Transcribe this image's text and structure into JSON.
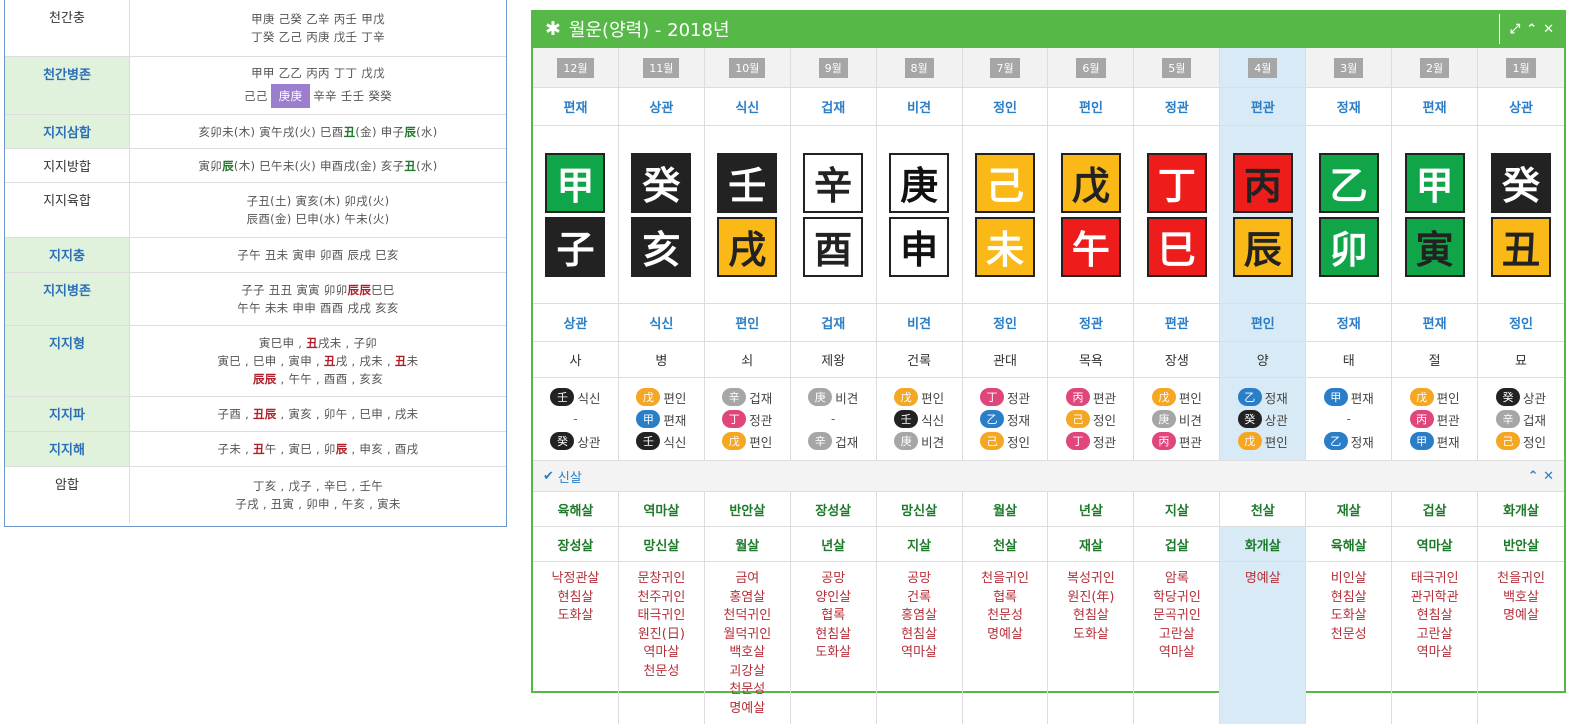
{
  "left_table": {
    "rows": [
      {
        "label": "천간충",
        "highlight": false,
        "lines": [
          "甲庚 己癸 乙辛 丙壬 甲戊",
          "丁癸 乙己 丙庚 戊壬 丁辛"
        ]
      },
      {
        "label": "천간병존",
        "highlight": true,
        "lines": [
          "甲甲 乙乙 丙丙 丁丁 戊戊"
        ],
        "line2_pre": "己己",
        "line2_box": "庚庚",
        "line2_post": "辛辛 壬壬 癸癸"
      },
      {
        "label": "지지삼합",
        "highlight": true,
        "line_a": "亥卯未(木) 寅午戌(火) 巳酉",
        "line_a_r1": "丑",
        "line_a_b": "(金) 申子",
        "line_a_r2": "辰",
        "line_a_c": "(水)"
      },
      {
        "label": "지지방합",
        "highlight": false,
        "line_a": "寅卯",
        "line_a_r1": "辰",
        "line_a_b": "(木) 巳午未(火) 申酉戌(金) 亥子",
        "line_a_r2": "丑",
        "line_a_c": "(水)"
      },
      {
        "label": "지지육합",
        "highlight": false,
        "lines": [
          "子丑(土) 寅亥(木) 卯戌(火)",
          "辰酉(金) 巳申(水) 午未(火)"
        ]
      },
      {
        "label": "지지충",
        "highlight": true,
        "lines": [
          "子午 丑未 寅申 卯酉 辰戌 巳亥"
        ]
      },
      {
        "label": "지지병존",
        "highlight": true,
        "line_a": "子子 丑丑 寅寅 卯卯",
        "line_a_r1": "辰辰",
        "line_a_b": "巳巳",
        "lines2": [
          "午午 未未 申申 酉酉 戌戌 亥亥"
        ]
      },
      {
        "label": "지지형",
        "highlight": true,
        "l1a": "寅巳申 , ",
        "l1r": "丑",
        "l1b": "戌未 , 子卯",
        "l2a": "寅巳 , 巳申 , 寅申 , ",
        "l2r1": "丑",
        "l2b": "戌 , 戌未 , ",
        "l2r2": "丑",
        "l2c": "未",
        "l3r": "辰辰",
        "l3b": " , 午午 , 酉酉 , 亥亥"
      },
      {
        "label": "지지파",
        "highlight": true,
        "la": "子酉 , ",
        "lr": "丑辰",
        "lb": " , 寅亥 , 卯午 , 巳申 , 戌未"
      },
      {
        "label": "지지해",
        "highlight": true,
        "la": "子未 , ",
        "lr": "丑",
        "lb": "午 , 寅巳 , 卯",
        "lr2": "辰",
        "lc": " , 申亥 , 酉戌"
      },
      {
        "label": "암합",
        "highlight": false,
        "lines": [
          "丁亥 , 戊子 , 辛巳 , 壬午",
          "子戌 , 丑寅 , 卯申 , 午亥 , 寅未"
        ]
      }
    ]
  },
  "panel": {
    "title": "월운(양력) - 2018년",
    "months": [
      "12월",
      "11월",
      "10월",
      "9월",
      "8월",
      "7월",
      "6월",
      "5월",
      "4월",
      "3월",
      "2월",
      "1월"
    ],
    "stem_gods": [
      "편재",
      "상관",
      "식신",
      "겁재",
      "비견",
      "정인",
      "편인",
      "정관",
      "편관",
      "정재",
      "편재",
      "상관"
    ],
    "stems": [
      {
        "ch": "甲",
        "bg": "#11a54a",
        "fg": "#ffffff"
      },
      {
        "ch": "癸",
        "bg": "#222222",
        "fg": "#ffffff"
      },
      {
        "ch": "壬",
        "bg": "#222222",
        "fg": "#ffffff"
      },
      {
        "ch": "辛",
        "bg": "#ffffff",
        "fg": "#222222"
      },
      {
        "ch": "庚",
        "bg": "#ffffff",
        "fg": "#111111"
      },
      {
        "ch": "己",
        "bg": "#fbb917",
        "fg": "#ffffff"
      },
      {
        "ch": "戊",
        "bg": "#fbb917",
        "fg": "#222222"
      },
      {
        "ch": "丁",
        "bg": "#ef1c1c",
        "fg": "#ffffff"
      },
      {
        "ch": "丙",
        "bg": "#ef1c1c",
        "fg": "#222222"
      },
      {
        "ch": "乙",
        "bg": "#11a54a",
        "fg": "#ffffff"
      },
      {
        "ch": "甲",
        "bg": "#11a54a",
        "fg": "#ffffff"
      },
      {
        "ch": "癸",
        "bg": "#222222",
        "fg": "#ffffff"
      }
    ],
    "branches": [
      {
        "ch": "子",
        "bg": "#222222",
        "fg": "#ffffff"
      },
      {
        "ch": "亥",
        "bg": "#222222",
        "fg": "#ffffff"
      },
      {
        "ch": "戌",
        "bg": "#fbb917",
        "fg": "#222222"
      },
      {
        "ch": "酉",
        "bg": "#ffffff",
        "fg": "#222222"
      },
      {
        "ch": "申",
        "bg": "#ffffff",
        "fg": "#111111"
      },
      {
        "ch": "未",
        "bg": "#fbb917",
        "fg": "#ffffff"
      },
      {
        "ch": "午",
        "bg": "#ef1c1c",
        "fg": "#ffffff"
      },
      {
        "ch": "巳",
        "bg": "#ef1c1c",
        "fg": "#ffffff"
      },
      {
        "ch": "辰",
        "bg": "#fbb917",
        "fg": "#222222"
      },
      {
        "ch": "卯",
        "bg": "#11a54a",
        "fg": "#ffffff"
      },
      {
        "ch": "寅",
        "bg": "#11a54a",
        "fg": "#222222"
      },
      {
        "ch": "丑",
        "bg": "#fbb917",
        "fg": "#222222"
      }
    ],
    "branch_gods": [
      "상관",
      "식신",
      "편인",
      "겁재",
      "비견",
      "정인",
      "정관",
      "편관",
      "편인",
      "정재",
      "편재",
      "정인"
    ],
    "stages": [
      "사",
      "병",
      "쇠",
      "제왕",
      "건록",
      "관대",
      "목욕",
      "장생",
      "양",
      "태",
      "절",
      "묘"
    ],
    "hidden": [
      [
        {
          "ch": "壬",
          "c": "#222222",
          "t": "식신"
        },
        {
          "dash": true
        },
        {
          "ch": "癸",
          "c": "#222222",
          "t": "상관"
        }
      ],
      [
        {
          "ch": "戊",
          "c": "#f5a623",
          "t": "편인"
        },
        {
          "ch": "甲",
          "c": "#2a7ec7",
          "t": "편재"
        },
        {
          "ch": "壬",
          "c": "#222222",
          "t": "식신"
        }
      ],
      [
        {
          "ch": "辛",
          "c": "#a6a6a6",
          "t": "겁재"
        },
        {
          "ch": "丁",
          "c": "#e0457b",
          "t": "정관"
        },
        {
          "ch": "戊",
          "c": "#f5a623",
          "t": "편인"
        }
      ],
      [
        {
          "ch": "庚",
          "c": "#a6a6a6",
          "t": "비견"
        },
        {
          "dash": true
        },
        {
          "ch": "辛",
          "c": "#a6a6a6",
          "t": "겁재"
        }
      ],
      [
        {
          "ch": "戊",
          "c": "#f5a623",
          "t": "편인"
        },
        {
          "ch": "壬",
          "c": "#222222",
          "t": "식신"
        },
        {
          "ch": "庚",
          "c": "#a6a6a6",
          "t": "비견"
        }
      ],
      [
        {
          "ch": "丁",
          "c": "#e0457b",
          "t": "정관"
        },
        {
          "ch": "乙",
          "c": "#2a7ec7",
          "t": "정재"
        },
        {
          "ch": "己",
          "c": "#f5a623",
          "t": "정인"
        }
      ],
      [
        {
          "ch": "丙",
          "c": "#e0457b",
          "t": "편관"
        },
        {
          "ch": "己",
          "c": "#f5a623",
          "t": "정인"
        },
        {
          "ch": "丁",
          "c": "#e0457b",
          "t": "정관"
        }
      ],
      [
        {
          "ch": "戊",
          "c": "#f5a623",
          "t": "편인"
        },
        {
          "ch": "庚",
          "c": "#a6a6a6",
          "t": "비견"
        },
        {
          "ch": "丙",
          "c": "#e0457b",
          "t": "편관"
        }
      ],
      [
        {
          "ch": "乙",
          "c": "#2a7ec7",
          "t": "정재"
        },
        {
          "ch": "癸",
          "c": "#222222",
          "t": "상관"
        },
        {
          "ch": "戊",
          "c": "#f5a623",
          "t": "편인"
        }
      ],
      [
        {
          "ch": "甲",
          "c": "#2a7ec7",
          "t": "편재"
        },
        {
          "dash": true
        },
        {
          "ch": "乙",
          "c": "#2a7ec7",
          "t": "정재"
        }
      ],
      [
        {
          "ch": "戊",
          "c": "#f5a623",
          "t": "편인"
        },
        {
          "ch": "丙",
          "c": "#e0457b",
          "t": "편관"
        },
        {
          "ch": "甲",
          "c": "#2a7ec7",
          "t": "편재"
        }
      ],
      [
        {
          "ch": "癸",
          "c": "#222222",
          "t": "상관"
        },
        {
          "ch": "辛",
          "c": "#a6a6a6",
          "t": "겁재"
        },
        {
          "ch": "己",
          "c": "#f5a623",
          "t": "정인"
        }
      ]
    ],
    "sinsal_label": "신살",
    "sal_row1": [
      "육해살",
      "역마살",
      "반안살",
      "장성살",
      "망신살",
      "월살",
      "년살",
      "지살",
      "천살",
      "재살",
      "겁살",
      "화개살"
    ],
    "sal_row2": [
      "장성살",
      "망신살",
      "월살",
      "년살",
      "지살",
      "천살",
      "재살",
      "겁살",
      "화개살",
      "육해살",
      "역마살",
      "반안살"
    ],
    "sal_lists": [
      [
        "낙정관살",
        "현침살",
        "도화살"
      ],
      [
        "문창귀인",
        "천주귀인",
        "태극귀인",
        "원진(日)",
        "역마살",
        "천문성"
      ],
      [
        "금여",
        "홍염살",
        "천덕귀인",
        "월덕귀인",
        "백호살",
        "괴강살",
        "천문성",
        "명예살"
      ],
      [
        "공망",
        "양인살",
        "협록",
        "현침살",
        "도화살"
      ],
      [
        "공망",
        "건록",
        "홍염살",
        "현침살",
        "역마살"
      ],
      [
        "천을귀인",
        "협록",
        "천문성",
        "명예살"
      ],
      [
        "복성귀인",
        "원진(年)",
        "현침살",
        "도화살"
      ],
      [
        "암록",
        "학당귀인",
        "문곡귀인",
        "고란살",
        "역마살"
      ],
      [
        "명예살"
      ],
      [
        "비인살",
        "현침살",
        "도화살",
        "천문성"
      ],
      [
        "태극귀인",
        "관귀학관",
        "현침살",
        "고란살",
        "역마살"
      ],
      [
        "천을귀인",
        "백호살",
        "명예살"
      ]
    ],
    "highlight_col": 8
  }
}
